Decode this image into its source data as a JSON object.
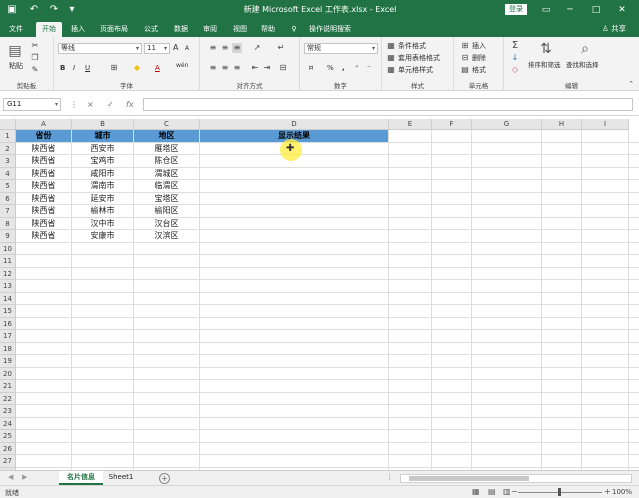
{
  "window": {
    "title": "新建 Microsoft Excel 工作表.xlsx - Excel",
    "login_label": "登录",
    "share_label": "共享"
  },
  "ribbon_tabs": [
    {
      "label": "文件"
    },
    {
      "label": "开始"
    },
    {
      "label": "插入"
    },
    {
      "label": "页面布局"
    },
    {
      "label": "公式"
    },
    {
      "label": "数据"
    },
    {
      "label": "审阅"
    },
    {
      "label": "视图"
    },
    {
      "label": "帮助"
    },
    {
      "label": "操作说明搜索"
    }
  ],
  "ribbon": {
    "clipboard": {
      "paste": "粘贴",
      "label": "剪贴板"
    },
    "font": {
      "family": "等线",
      "size": "11",
      "bold": "B",
      "italic": "I",
      "underline": "U",
      "grow": "A",
      "shrink": "A",
      "color_letter": "A",
      "wen": "wén",
      "label": "字体"
    },
    "alignment": {
      "label": "对齐方式"
    },
    "number": {
      "format": "常规",
      "percent": "%",
      "comma": ",",
      "label": "数字"
    },
    "styles": {
      "conditional": "条件格式",
      "table": "套用表格格式",
      "cell": "单元格样式",
      "label": "样式"
    },
    "cells": {
      "insert": "插入",
      "delete": "删除",
      "format": "格式",
      "label": "单元格"
    },
    "editing": {
      "sort_filter": "排序和筛选",
      "find_select": "查找和选择",
      "label": "编辑"
    }
  },
  "formula_bar": {
    "name_box": "G11",
    "cancel": "×",
    "enter": "✓",
    "fx": "fx",
    "value": ""
  },
  "columns": [
    "A",
    "B",
    "C",
    "D",
    "E",
    "F",
    "G",
    "H",
    "I"
  ],
  "rows": [
    "1",
    "2",
    "3",
    "4",
    "5",
    "6",
    "7",
    "8",
    "9",
    "10",
    "11",
    "12",
    "13",
    "14",
    "15",
    "16",
    "17",
    "18",
    "19",
    "20",
    "21",
    "22",
    "23",
    "24",
    "25",
    "26",
    "27",
    "28"
  ],
  "header_row": [
    "省份",
    "城市",
    "地区",
    "显示结果"
  ],
  "table_rows": [
    [
      "陕西省",
      "西安市",
      "雁塔区"
    ],
    [
      "陕西省",
      "宝鸡市",
      "陈仓区"
    ],
    [
      "陕西省",
      "咸阳市",
      "渭城区"
    ],
    [
      "陕西省",
      "渭南市",
      "临渭区"
    ],
    [
      "陕西省",
      "延安市",
      "宝塔区"
    ],
    [
      "陕西省",
      "榆林市",
      "榆阳区"
    ],
    [
      "陕西省",
      "汉中市",
      "汉台区"
    ],
    [
      "陕西省",
      "安康市",
      "汉滨区"
    ]
  ],
  "sheet_tabs": [
    {
      "label": "名片信息",
      "active": true
    },
    {
      "label": "Sheet1",
      "active": false
    }
  ],
  "status": {
    "ready": "就绪",
    "zoom": "100%"
  },
  "colors": {
    "excel_green": "#217346",
    "header_fill": "#5b9bd5",
    "cursor": "#ffec3c"
  }
}
